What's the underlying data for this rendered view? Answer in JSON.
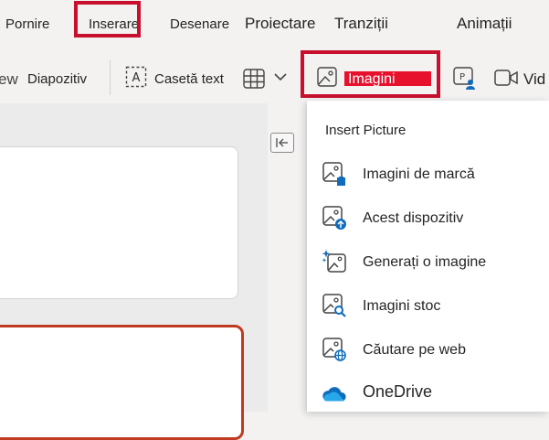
{
  "menu": {
    "tabs": [
      {
        "label": "Pornire"
      },
      {
        "label": "Inserare"
      },
      {
        "label": "Desenare"
      },
      {
        "label": "Proiectare"
      },
      {
        "label": "Tranziții"
      },
      {
        "label": "Animații"
      }
    ]
  },
  "toolbar": {
    "new_slide_partial": "ew",
    "new_slide_label": "Diapozitiv",
    "textbox_label": "Casetă text",
    "images_label": "Imagini",
    "video_partial": "Vid"
  },
  "dropdown": {
    "heading": "Insert Picture",
    "items": [
      {
        "label": "Imagini de marcă",
        "icon": "brand-image-icon"
      },
      {
        "label": "Acest dispozitiv",
        "icon": "upload-image-icon"
      },
      {
        "label": "Generați o imagine",
        "icon": "generate-image-icon"
      },
      {
        "label": "Imagini stoc",
        "icon": "stock-image-icon"
      },
      {
        "label": "Căutare pe web",
        "icon": "web-image-icon"
      },
      {
        "label": "OneDrive",
        "icon": "onedrive-icon"
      }
    ]
  },
  "colors": {
    "highlight_red": "#c8102e",
    "accent_blue": "#0f6cbd",
    "slide_border": "#c03a22"
  }
}
